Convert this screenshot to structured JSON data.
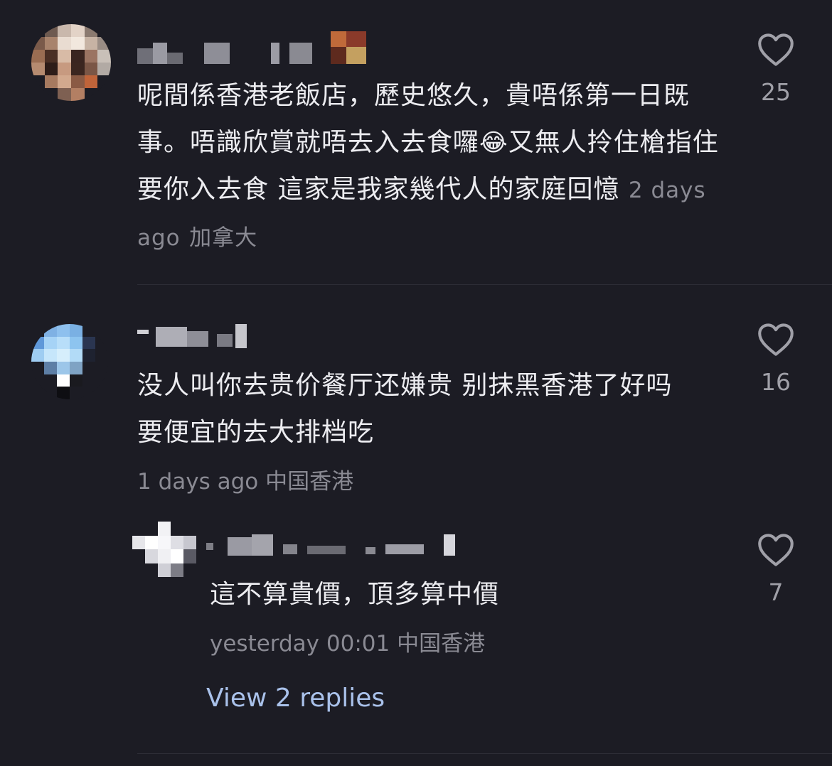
{
  "comments": [
    {
      "text": "呢間係香港老飯店，歷史悠久，貴唔係第一日既事。唔識欣賞就唔去入去食囉",
      "text_after_emoji": "又無人拎住槍指住要你入去食 這家是我家幾代人的家庭回憶",
      "emoji": "😂",
      "time": "2 days ago",
      "location": "加拿大",
      "likes": "25"
    },
    {
      "text": "没人叫你去贵价餐厅还嫌贵 别抹黑香港了好吗 要便宜的去大排档吃",
      "time": "1 days ago",
      "location": "中国香港",
      "likes": "16"
    },
    {
      "text": "這不算貴價，頂多算中價",
      "time": "yesterday 00:01",
      "location": "中国香港",
      "likes": "7"
    }
  ],
  "view_replies": "View 2 replies",
  "colors": {
    "background": "#1c1c24",
    "text": "#ececf0",
    "meta": "#8a8a93",
    "link": "#a9c1ea"
  },
  "icons": {
    "like": "heart-outline-icon"
  }
}
